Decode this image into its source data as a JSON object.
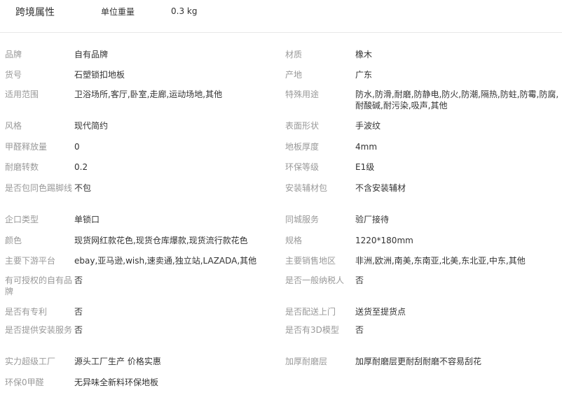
{
  "header": {
    "title": "跨境属性",
    "weight_label": "单位重量",
    "weight_value": "0.3 kg"
  },
  "attributes": [
    {
      "l_label": "品牌",
      "l_value": "自有品牌",
      "r_label": "材质",
      "r_value": "橡木"
    },
    {
      "l_label": "货号",
      "l_value": "石塑锁扣地板",
      "r_label": "产地",
      "r_value": "广东"
    },
    {
      "l_label": "适用范围",
      "l_value": "卫浴场所,客厅,卧室,走廊,运动场地,其他",
      "r_label": "特殊用途",
      "r_value": "防水,防滑,耐磨,防静电,防火,防潮,隔热,防蛀,防霉,防腐,耐酸碱,耐污染,吸声,其他"
    },
    {
      "l_label": "风格",
      "l_value": "现代简约",
      "r_label": "表面形状",
      "r_value": "手波纹"
    },
    {
      "l_label": "甲醛释放量",
      "l_value": "0",
      "r_label": "地板厚度",
      "r_value": "4mm"
    },
    {
      "l_label": "耐磨转数",
      "l_value": "0.2",
      "r_label": "环保等级",
      "r_value": "E1级"
    },
    {
      "l_label": "是否包同色踢脚线",
      "l_value": "不包",
      "r_label": "安装辅材包",
      "r_value": "不含安装辅材"
    },
    {
      "l_label": "企口类型",
      "l_value": "单锁口",
      "r_label": "同城服务",
      "r_value": "验厂接待"
    },
    {
      "l_label": "颜色",
      "l_value": "现货网红款花色,现货仓库爆款,现货流行款花色",
      "r_label": "规格",
      "r_value": "1220*180mm"
    },
    {
      "l_label": "主要下游平台",
      "l_value": "ebay,亚马逊,wish,速卖通,独立站,LAZADA,其他",
      "r_label": "主要销售地区",
      "r_value": "非洲,欧洲,南美,东南亚,北美,东北亚,中东,其他"
    },
    {
      "l_label": "有可授权的自有品牌",
      "l_value": "否",
      "r_label": "是否一般纳税人",
      "r_value": "否"
    },
    {
      "l_label": "是否有专利",
      "l_value": "否",
      "r_label": "是否配送上门",
      "r_value": "送货至提货点"
    },
    {
      "l_label": "是否提供安装服务",
      "l_value": "否",
      "r_label": "是否有3D模型",
      "r_value": "否"
    },
    {
      "l_label": "实力超级工厂",
      "l_value": "源头工厂生产 价格实惠",
      "r_label": "加厚耐磨层",
      "r_value": "加厚耐磨层更耐刮耐磨不容易刮花"
    },
    {
      "l_label": "环保0甲醛",
      "l_value": "无异味全新料环保地板",
      "r_label": "",
      "r_value": ""
    }
  ]
}
